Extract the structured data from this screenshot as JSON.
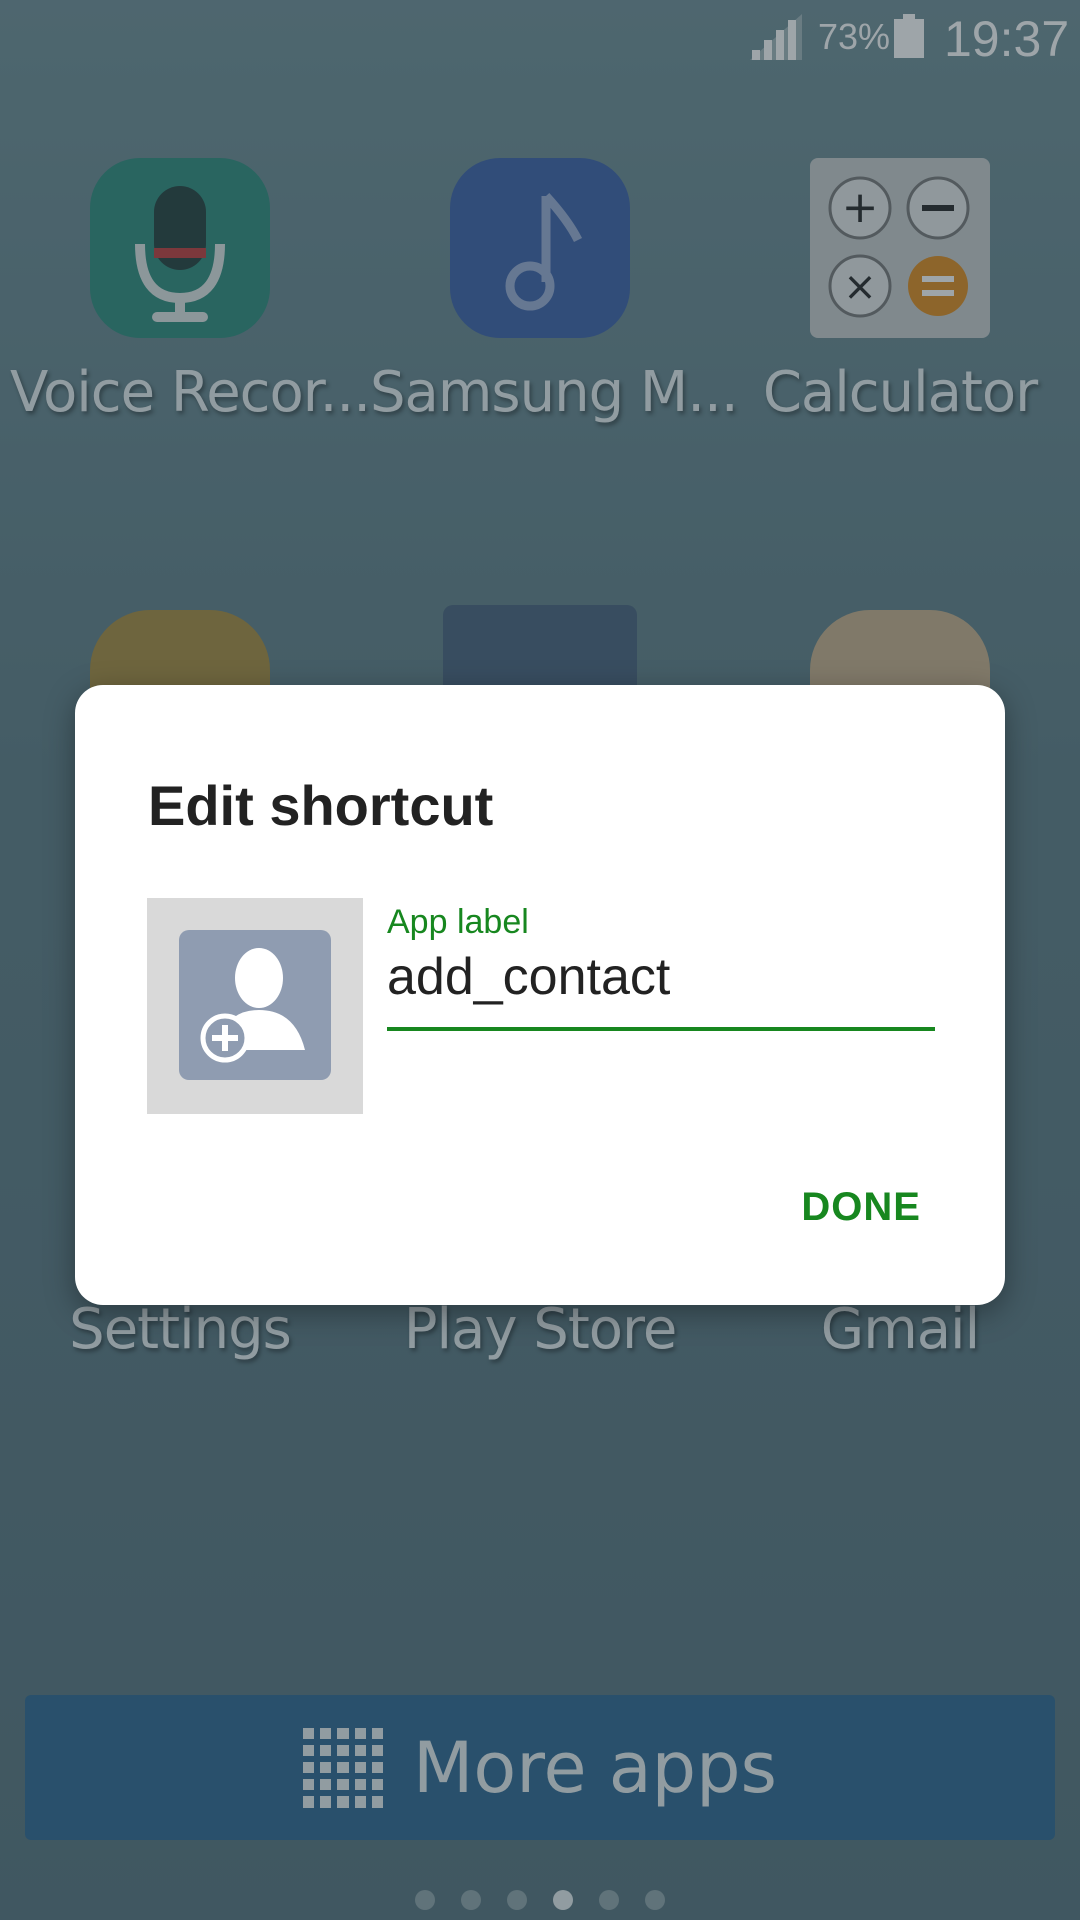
{
  "statusbar": {
    "battery": "73%",
    "time": "19:37"
  },
  "apps": [
    {
      "label": "Voice Recor...",
      "icon": "voice-recorder-icon",
      "color": "#2a8a7a"
    },
    {
      "label": "Samsung M...",
      "icon": "music-note-icon",
      "color": "#3a5fa8"
    },
    {
      "label": "Calculator",
      "icon": "calculator-icon",
      "color": "#c8cccc"
    },
    {
      "label": "Settings",
      "icon": "folder-icon",
      "color": "#a88a3c"
    },
    {
      "label": "Play Store",
      "icon": "contact-icon",
      "color": "#45607a"
    },
    {
      "label": "Gmail",
      "icon": "notepad-icon",
      "color": "#c9b08a"
    }
  ],
  "more_apps": {
    "label": "More apps"
  },
  "page_indicator": {
    "count": 6,
    "active_index": 3
  },
  "dialog": {
    "title": "Edit shortcut",
    "field_label": "App label",
    "field_value": "add_contact",
    "done_label": "DONE",
    "accent": "#17871f"
  }
}
